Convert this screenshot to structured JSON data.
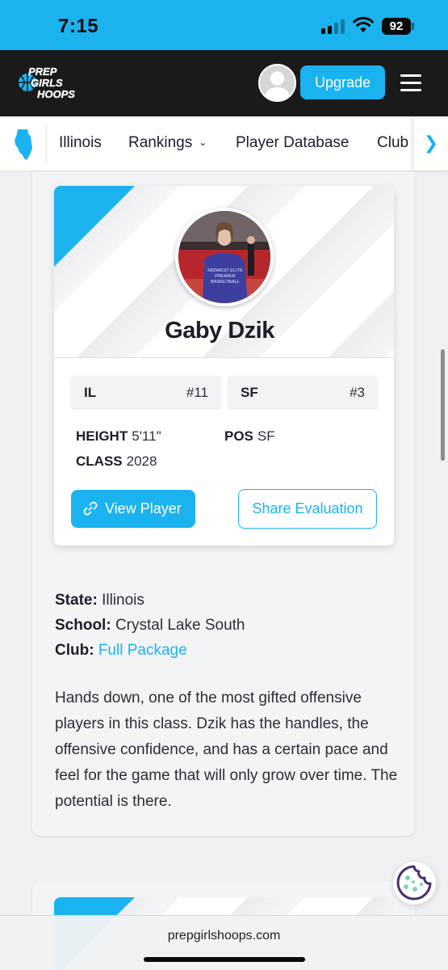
{
  "status_bar": {
    "time": "7:15",
    "battery": "92"
  },
  "header": {
    "logo": {
      "line1": "PREP",
      "line2": "GIRLS",
      "line3": "HOOPS"
    },
    "upgrade_label": "Upgrade"
  },
  "nav": {
    "items": [
      "Illinois",
      "Rankings",
      "Player Database",
      "Club"
    ]
  },
  "player": {
    "name": "Gaby Dzik",
    "photo_shirt_text": [
      "MIDWEST ELITE",
      "PREMIER",
      "BASKETBALL"
    ],
    "rankings": [
      {
        "label": "IL",
        "value": "#11"
      },
      {
        "label": "SF",
        "value": "#3"
      }
    ],
    "stats": {
      "height_label": "HEIGHT",
      "height_value": "5'11\"",
      "pos_label": "POS",
      "pos_value": "SF",
      "class_label": "CLASS",
      "class_value": "2028"
    },
    "view_label": "View Player",
    "share_label": "Share Evaluation"
  },
  "details": {
    "state_label": "State:",
    "state_value": "Illinois",
    "school_label": "School:",
    "school_value": "Crystal Lake South",
    "club_label": "Club:",
    "club_value": "Full Package"
  },
  "evaluation": "Hands down, one of the most gifted offensive players in this class. Dzik has the handles, the offensive confidence, and has a certain pace and feel for the game that will only grow over time. The potential is there.",
  "browser": {
    "url": "prepgirlshoops.com"
  },
  "colors": {
    "accent": "#1ab3f0",
    "header_bg": "#1a1a1a",
    "text": "#1b1f2a"
  }
}
